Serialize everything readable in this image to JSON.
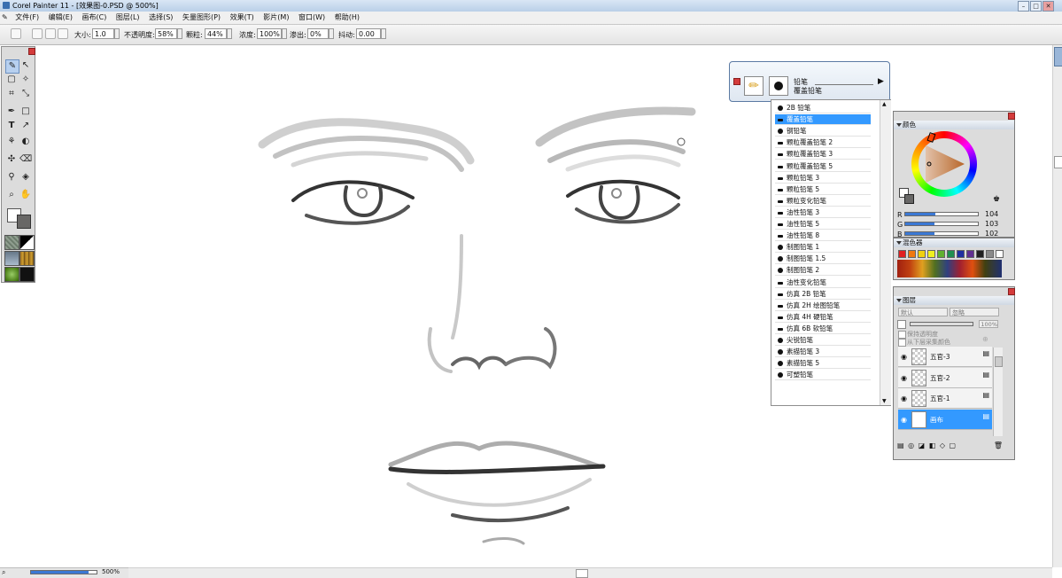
{
  "window": {
    "title": "Corel Painter 11 - [效果图-0.PSD @ 500%]"
  },
  "menu": [
    "文件(F)",
    "编辑(E)",
    "画布(C)",
    "图层(L)",
    "选择(S)",
    "矢量图形(P)",
    "效果(T)",
    "影片(M)",
    "窗口(W)",
    "帮助(H)"
  ],
  "propbar": {
    "size_label": "大小:",
    "size_value": "1.0",
    "opacity_label": "不透明度:",
    "opacity_value": "58%",
    "grain_label": "颗粒:",
    "grain_value": "44%",
    "density_label": "浓度:",
    "density_value": "100%",
    "bleed_label": "渗出:",
    "bleed_value": "0%",
    "jitter_label": "抖动:",
    "jitter_value": "0.00"
  },
  "brush_selector": {
    "category": "铅笔",
    "variant": "覆盖铅笔"
  },
  "brush_list": {
    "items": [
      "2B 铅笔",
      "覆盖铅笔",
      "钢铅笔",
      "颗粒覆盖铅笔 2",
      "颗粒覆盖铅笔 3",
      "颗粒覆盖铅笔 5",
      "颗粒铅笔 3",
      "颗粒铅笔 5",
      "颗粒变化铅笔",
      "油性铅笔 3",
      "油性铅笔 5",
      "油性铅笔 8",
      "制图铅笔 1",
      "制图铅笔 1.5",
      "制图铅笔 2",
      "油性变化铅笔",
      "仿真 2B 铅笔",
      "仿真 2H 绘图铅笔",
      "仿真 4H 硬铅笔",
      "仿真 6B 软铅笔",
      "尖锐铅笔",
      "素描铅笔 3",
      "素描铅笔 5",
      "可塑铅笔"
    ],
    "selected_index": 1
  },
  "color_panel": {
    "title": "颜色",
    "r_label": "R",
    "r_value": "104",
    "g_label": "G",
    "g_value": "103",
    "b_label": "B",
    "b_value": "102",
    "current_color": "#686766"
  },
  "mixer_panel": {
    "title": "混色器",
    "swatches": [
      "#e02020",
      "#f07810",
      "#f0d010",
      "#f0f020",
      "#60b030",
      "#209050",
      "#2030a0",
      "#603090",
      "#202020",
      "#8a8a8a",
      "#ffffff"
    ]
  },
  "layers_panel": {
    "title": "图层",
    "composite_method": "默认",
    "composite_depth": "忽略",
    "opacity_value": "100%",
    "preserve_transparency": "保持透明度",
    "pick_up_color": "从下层采集颜色",
    "layers": [
      "五官-3",
      "五官-2",
      "五官-1",
      "画布"
    ],
    "selected_layer": "画布"
  },
  "status": {
    "zoom": "500%"
  }
}
